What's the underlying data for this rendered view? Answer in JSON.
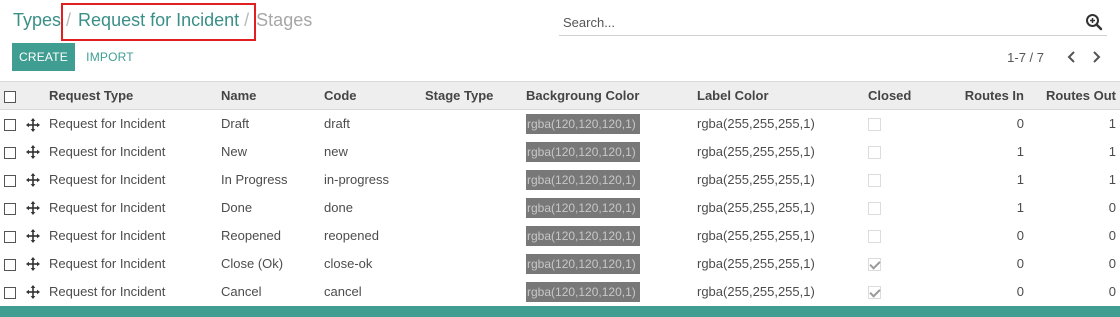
{
  "breadcrumb": {
    "types": "Types",
    "separator": "/",
    "request": "Request for Incident",
    "stages": "Stages"
  },
  "search": {
    "placeholder": "Search..."
  },
  "toolbar": {
    "create": "CREATE",
    "import": "IMPORT"
  },
  "pager": {
    "value": "1-7 / 7"
  },
  "columns": {
    "request_type": "Request Type",
    "name": "Name",
    "code": "Code",
    "stage_type": "Stage Type",
    "bg_color": "Backgroung Color",
    "label_color": "Label Color",
    "closed": "Closed",
    "routes_in": "Routes In",
    "routes_out": "Routes Out"
  },
  "rows": [
    {
      "request_type": "Request for Incident",
      "name": "Draft",
      "code": "draft",
      "stage_type": "",
      "bg_color": "rgba(120,120,120,1)",
      "label_color": "rgba(255,255,255,1)",
      "closed": false,
      "routes_in": "0",
      "routes_out": "1"
    },
    {
      "request_type": "Request for Incident",
      "name": "New",
      "code": "new",
      "stage_type": "",
      "bg_color": "rgba(120,120,120,1)",
      "label_color": "rgba(255,255,255,1)",
      "closed": false,
      "routes_in": "1",
      "routes_out": "1"
    },
    {
      "request_type": "Request for Incident",
      "name": "In Progress",
      "code": "in-progress",
      "stage_type": "",
      "bg_color": "rgba(120,120,120,1)",
      "label_color": "rgba(255,255,255,1)",
      "closed": false,
      "routes_in": "1",
      "routes_out": "1"
    },
    {
      "request_type": "Request for Incident",
      "name": "Done",
      "code": "done",
      "stage_type": "",
      "bg_color": "rgba(120,120,120,1)",
      "label_color": "rgba(255,255,255,1)",
      "closed": false,
      "routes_in": "1",
      "routes_out": "0"
    },
    {
      "request_type": "Request for Incident",
      "name": "Reopened",
      "code": "reopened",
      "stage_type": "",
      "bg_color": "rgba(120,120,120,1)",
      "label_color": "rgba(255,255,255,1)",
      "closed": false,
      "routes_in": "0",
      "routes_out": "0"
    },
    {
      "request_type": "Request for Incident",
      "name": "Close (Ok)",
      "code": "close-ok",
      "stage_type": "",
      "bg_color": "rgba(120,120,120,1)",
      "label_color": "rgba(255,255,255,1)",
      "closed": true,
      "routes_in": "0",
      "routes_out": "0"
    },
    {
      "request_type": "Request for Incident",
      "name": "Cancel",
      "code": "cancel",
      "stage_type": "",
      "bg_color": "rgba(120,120,120,1)",
      "label_color": "rgba(255,255,255,1)",
      "closed": true,
      "routes_in": "0",
      "routes_out": "0"
    }
  ],
  "colors": {
    "accent": "#3f9d92",
    "link": "#3a8f88",
    "highlight": "#e02020",
    "swatch": "#787878"
  },
  "icons": {
    "search": "zoom-search-icon",
    "handle": "drag-handle-icon",
    "prev": "chevron-left-icon",
    "next": "chevron-right-icon"
  }
}
